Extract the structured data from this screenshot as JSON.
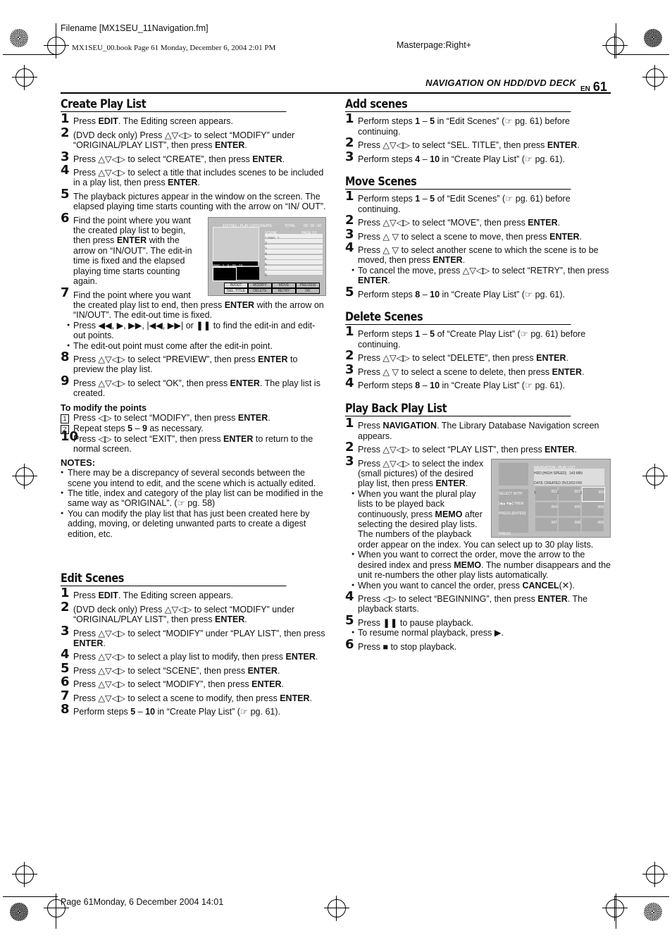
{
  "meta": {
    "filename": "Filename [MX1SEU_11Navigation.fm]",
    "book": "MX1SEU_00.book  Page 61  Monday, December 6, 2004  2:01 PM",
    "masterpage": "Masterpage:Right+",
    "footer": "Page 61Monday, 6 December 2004  14:01"
  },
  "header": {
    "title": "NAVIGATION ON HDD/DVD DECK",
    "lang": "EN",
    "page": "61"
  },
  "create": {
    "title": "Create Play List",
    "steps": [
      {
        "n": "1",
        "t": "Press **EDIT**. The Editing screen appears."
      },
      {
        "n": "2",
        "t": "(DVD deck only) Press △▽◁▷ to select “MODIFY” under “ORIGINAL/PLAY LIST”, then press **ENTER**."
      },
      {
        "n": "3",
        "t": "Press △▽◁▷ to select “CREATE”, then press **ENTER**."
      },
      {
        "n": "4",
        "t": "Press △▽◁▷ to select a title that includes scenes to be included in a play list, then press **ENTER**."
      },
      {
        "n": "5",
        "t": "The playback pictures appear in the window on the screen. The elapsed playing time starts counting with the arrow on “IN/ OUT”."
      },
      {
        "n": "6",
        "t": "Find the point where you want the created play list to begin, then press **ENTER** with the arrow on “IN/OUT”. The edit-in time is fixed and the elapsed playing time starts counting again.",
        "img": true
      },
      {
        "n": "7",
        "t": "Find the point where you want the created play list to end, then press **ENTER** with the arrow on “IN/OUT”. The edit-out time is fixed.",
        "bullets": [
          "Press ◀◀, ▶, ▶▶, |◀◀, ▶▶| or ❚❚ to find the edit-in and edit-out points.",
          "The edit-out point must come after the edit-in point."
        ]
      },
      {
        "n": "8",
        "t": "Press △▽◁▷ to select “PREVIEW”, then press **ENTER** to preview the play list."
      },
      {
        "n": "9",
        "t": "Press △▽◁▷ to select “OK”, then press **ENTER**. The play list is created."
      }
    ],
    "modify_title": "To modify the points",
    "modify": [
      {
        "n": "1",
        "t": "Press ◁▷ to select “MODIFY”, then press **ENTER**."
      },
      {
        "n": "2",
        "t": "Repeat steps **5** – **9** as necessary."
      }
    ],
    "step10": {
      "n": "10",
      "t": "Press ◁▷ to select “EXIT”, then press **ENTER** to return to the normal screen."
    },
    "notes_title": "NOTES:",
    "notes": [
      "There may be a discrepancy of several seconds between the scene you intend to edit, and the scene which is actually edited.",
      "The title, index and category of the play list can be modified in the same way as “ORIGINAL”. (☞ pg. 58)",
      "You can modify the play list that has just been created here by adding, moving, or deleting unwanted parts to create a digest edition, etc."
    ],
    "screen": {
      "title": "EDITING › PLAY LIST/CREATE",
      "total": "TOTAL",
      "time": "00 : 00 : 00",
      "scene": "SCENE",
      "page": "PAGE",
      "page_val": "1/1",
      "rows": [
        "1  PRG. 1",
        "2",
        "3",
        "4",
        "5",
        "6",
        "7",
        "8"
      ],
      "prg": "PRG. 1",
      "elapsed": "0 : 00 : 15",
      "in": "IN",
      "out": "OUT",
      "buttons": [
        "IN/OUT",
        "MODIFY",
        "MOVE",
        "PREVIEW",
        "SEL. TITLE",
        "DELETE",
        "RETRY",
        "OK"
      ]
    }
  },
  "edit": {
    "title": "Edit Scenes",
    "steps": [
      {
        "n": "1",
        "t": "Press **EDIT**. The Editing screen appears."
      },
      {
        "n": "2",
        "t": "(DVD deck only) Press △▽◁▷ to select “MODIFY” under “ORIGINAL/PLAY LIST”, then press **ENTER**."
      },
      {
        "n": "3",
        "t": "Press △▽◁▷ to select “MODIFY” under “PLAY LIST”, then press **ENTER**."
      },
      {
        "n": "4",
        "t": "Press △▽◁▷ to select a play list to modify, then press **ENTER**."
      },
      {
        "n": "5",
        "t": "Press △▽◁▷ to select “SCENE”, then press **ENTER**."
      },
      {
        "n": "6",
        "t": "Press △▽◁▷ to select “MODIFY”, then press **ENTER**."
      },
      {
        "n": "7",
        "t": "Press △▽◁▷ to select a scene to modify, then press **ENTER**."
      },
      {
        "n": "8",
        "t": "Perform steps **5** – **10** in “Create Play List” (☞ pg. 61)."
      }
    ]
  },
  "add": {
    "title": "Add scenes",
    "steps": [
      {
        "n": "1",
        "t": "Perform steps **1** – **5** in “Edit Scenes” (☞ pg. 61) before continuing."
      },
      {
        "n": "2",
        "t": "Press △▽◁▷ to select “SEL. TITLE”, then press **ENTER**."
      },
      {
        "n": "3",
        "t": "Perform steps **4** – **10** in “Create Play List” (☞ pg. 61)."
      }
    ]
  },
  "move": {
    "title": "Move Scenes",
    "steps": [
      {
        "n": "1",
        "t": "Perform steps **1** – **5** of “Edit Scenes” (☞ pg. 61) before continuing."
      },
      {
        "n": "2",
        "t": "Press △▽◁▷ to select “MOVE”, then press **ENTER**."
      },
      {
        "n": "3",
        "t": "Press △ ▽ to select a scene to move, then press **ENTER**."
      },
      {
        "n": "4",
        "t": "Press △ ▽ to select another scene to which the scene is to be moved, then press **ENTER**.",
        "bullets": [
          "To cancel the move, press △▽◁▷ to select “RETRY”, then press **ENTER**."
        ]
      },
      {
        "n": "5",
        "t": "Perform steps **8** – **10** in “Create Play List” (☞ pg. 61)."
      }
    ]
  },
  "delete": {
    "title": "Delete Scenes",
    "steps": [
      {
        "n": "1",
        "t": "Perform steps **1** – **5** of “Create Play List” (☞ pg. 61) before continuing."
      },
      {
        "n": "2",
        "t": "Press △▽◁▷ to select “DELETE”, then press **ENTER**."
      },
      {
        "n": "3",
        "t": "Press △ ▽ to select a scene to delete, then press **ENTER**."
      },
      {
        "n": "4",
        "t": "Perform steps **8** – **10** in “Create Play List” (☞ pg. 61)."
      }
    ]
  },
  "playback": {
    "title": "Play Back Play List",
    "steps": [
      {
        "n": "1",
        "t": "Press **NAVIGATION**. The Library Database Navigation screen appears."
      },
      {
        "n": "2",
        "t": "Press △▽◁▷ to select “PLAY LIST”, then press **ENTER**."
      },
      {
        "n": "3",
        "t": "Press △▽◁▷ to select the index (small pictures) of the desired play list, then press **ENTER**.",
        "img": true,
        "bullets": [
          "When you want the plural play lists to be played back continuously, press **MEMO** after selecting the desired play lists. The numbers of the playback order appear on the index. You can select up to 30 play lists.",
          "When you want to correct the order, move the arrow to the desired index and press **MEMO**. The number disappears and the unit re-numbers the other play lists automatically.",
          "When you want to cancel the order, press **CANCEL**(✕)."
        ]
      },
      {
        "n": "4",
        "t": "Press ◁▷ to select “BEGINNING”, then press **ENTER**. The playback starts."
      },
      {
        "n": "5",
        "t": "Press ❚❚ to pause playback.",
        "bullets": [
          "To resume normal playback, press ▶."
        ]
      },
      {
        "n": "6",
        "t": "Press ■ to stop playback."
      }
    ],
    "screen": {
      "title": "NAVIGATION › PLAY LIST",
      "info": "HDD  [HIGH SPEED]",
      "remain": "143 MIN",
      "created": "DATE CREATED 25/12/03 FRI",
      "name": "TEDDY BEAR 25/12",
      "cat": "[MOVIES]",
      "help1": "SELECT WITH [◀▲▼▶] THEN PRESS [ENTER]",
      "help2": "PRESS [NAVIGATION] TO EXIT",
      "nums": [
        "001",
        "002",
        "003",
        "004",
        "005",
        "006",
        "007",
        "008",
        "009"
      ],
      "nav": "NAVIGATION",
      "enter": "ENTER",
      "exit": "EXIT",
      "select": "SELECT"
    }
  }
}
